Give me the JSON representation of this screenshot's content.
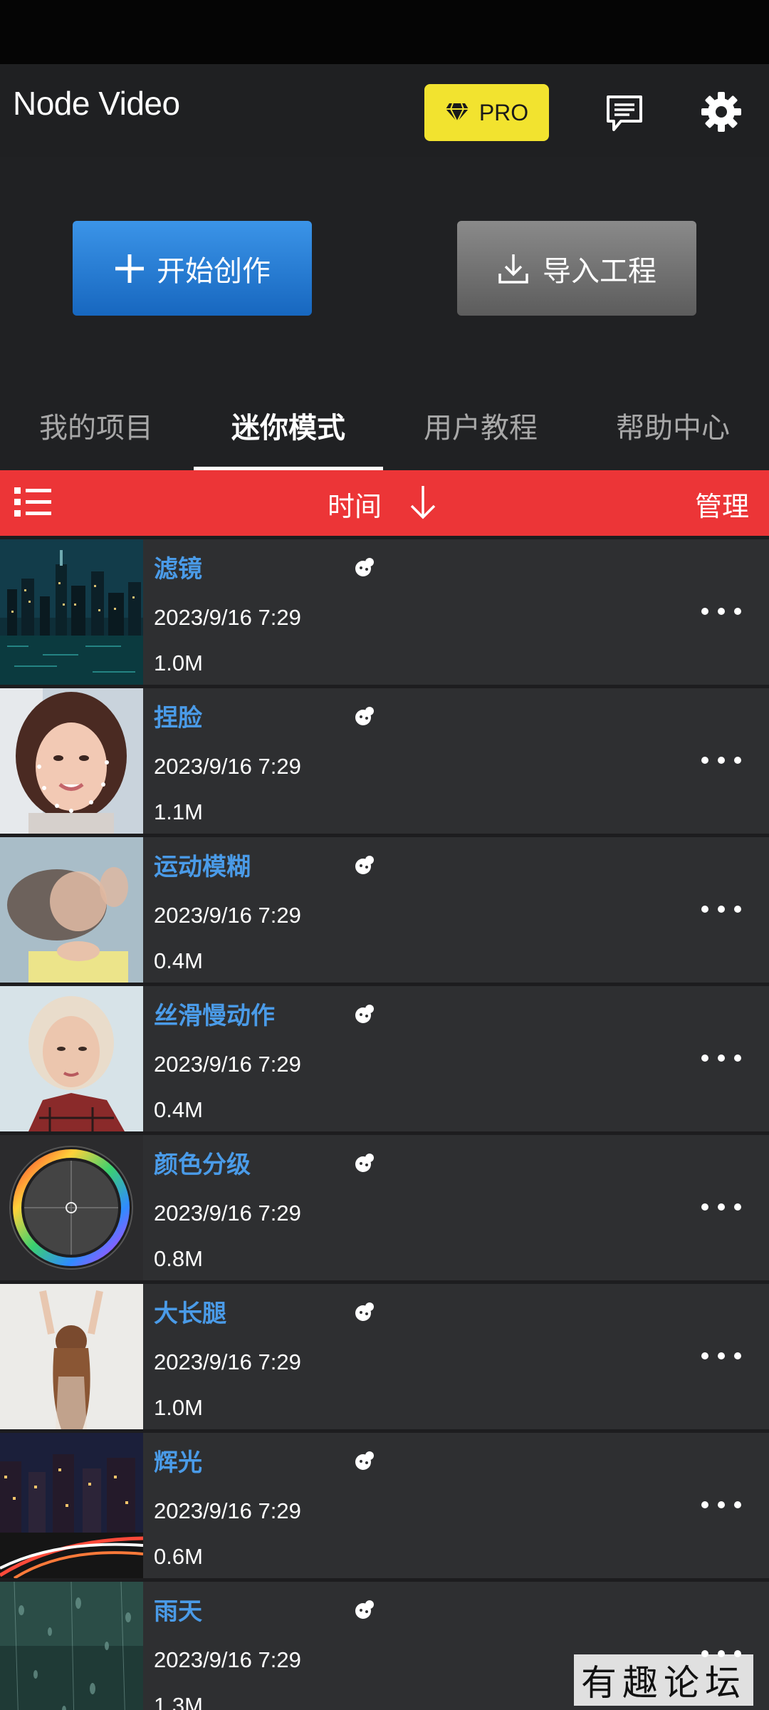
{
  "header": {
    "app_title": "Node Video",
    "pro_label": "PRO",
    "pro_color": "#f2e32f"
  },
  "actions": {
    "create_label": "开始创作",
    "import_label": "导入工程"
  },
  "tabs": [
    {
      "label": "我的项目",
      "active": false
    },
    {
      "label": "迷你模式",
      "active": true
    },
    {
      "label": "用户教程",
      "active": false
    },
    {
      "label": "帮助中心",
      "active": false
    }
  ],
  "sort_bar": {
    "sort_label": "时间",
    "manage_label": "管理",
    "bar_color": "#ec3537"
  },
  "projects": [
    {
      "name": "滤镜",
      "date": "2023/9/16 7:29",
      "size": "1.0M"
    },
    {
      "name": "捏脸",
      "date": "2023/9/16 7:29",
      "size": "1.1M"
    },
    {
      "name": "运动模糊",
      "date": "2023/9/16 7:29",
      "size": "0.4M"
    },
    {
      "name": "丝滑慢动作",
      "date": "2023/9/16 7:29",
      "size": "0.4M"
    },
    {
      "name": "颜色分级",
      "date": "2023/9/16 7:29",
      "size": "0.8M"
    },
    {
      "name": "大长腿",
      "date": "2023/9/16 7:29",
      "size": "1.0M"
    },
    {
      "name": "辉光",
      "date": "2023/9/16 7:29",
      "size": "0.6M"
    },
    {
      "name": "雨天",
      "date": "2023/9/16 7:29",
      "size": "1.3M"
    }
  ],
  "icons": {
    "pro": "diamond-icon",
    "messages": "message-icon",
    "settings": "gear-icon",
    "create": "plus-icon",
    "import": "download-icon",
    "view": "list-icon",
    "sort": "arrow-down-icon",
    "mini_mode": "mini-mode-icon",
    "more": "more-icon"
  },
  "watermark": "有趣论坛"
}
